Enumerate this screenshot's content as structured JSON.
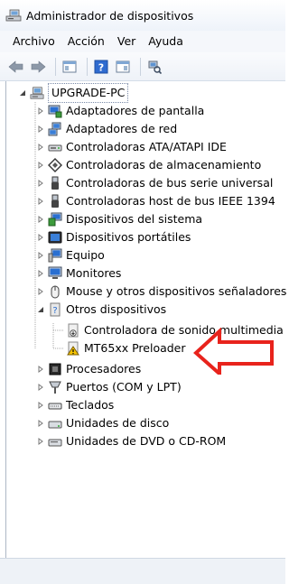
{
  "window": {
    "title": "Administrador de dispositivos"
  },
  "menu": [
    "Archivo",
    "Acción",
    "Ver",
    "Ayuda"
  ],
  "toolbar": {
    "buttons": [
      "back-icon",
      "forward-icon",
      "properties-icon",
      "help-icon",
      "view-icon",
      "scan-hardware-icon"
    ]
  },
  "tree": {
    "root": "UPGRADE-PC",
    "items": [
      {
        "label": "Adaptadores de pantalla",
        "icon": "display-adapter-icon"
      },
      {
        "label": "Adaptadores de red",
        "icon": "network-adapter-icon"
      },
      {
        "label": "Controladoras ATA/ATAPI IDE",
        "icon": "ide-controller-icon"
      },
      {
        "label": "Controladoras de almacenamiento",
        "icon": "storage-controller-icon"
      },
      {
        "label": "Controladoras de bus serie universal",
        "icon": "usb-icon"
      },
      {
        "label": "Controladoras host de bus IEEE 1394",
        "icon": "ieee1394-icon"
      },
      {
        "label": "Dispositivos del sistema",
        "icon": "system-devices-icon"
      },
      {
        "label": "Dispositivos portátiles",
        "icon": "portable-devices-icon"
      },
      {
        "label": "Equipo",
        "icon": "computer-icon"
      },
      {
        "label": "Monitores",
        "icon": "monitor-icon"
      },
      {
        "label": "Mouse y otros dispositivos señaladores",
        "icon": "mouse-icon"
      },
      {
        "label": "Otros dispositivos",
        "icon": "other-devices-icon"
      },
      {
        "label": "Controladora de sonido multimedia",
        "icon": "unknown-device-icon"
      },
      {
        "label": "MT65xx Preloader",
        "icon": "unknown-device-warning-icon"
      },
      {
        "label": "Procesadores",
        "icon": "processor-icon"
      },
      {
        "label": "Puertos (COM y LPT)",
        "icon": "port-icon"
      },
      {
        "label": "Teclados",
        "icon": "keyboard-icon"
      },
      {
        "label": "Unidades de disco",
        "icon": "disk-drive-icon"
      },
      {
        "label": "Unidades de DVD o CD-ROM",
        "icon": "dvd-drive-icon"
      }
    ]
  },
  "colors": {
    "annotation_arrow": "#e8231c"
  }
}
